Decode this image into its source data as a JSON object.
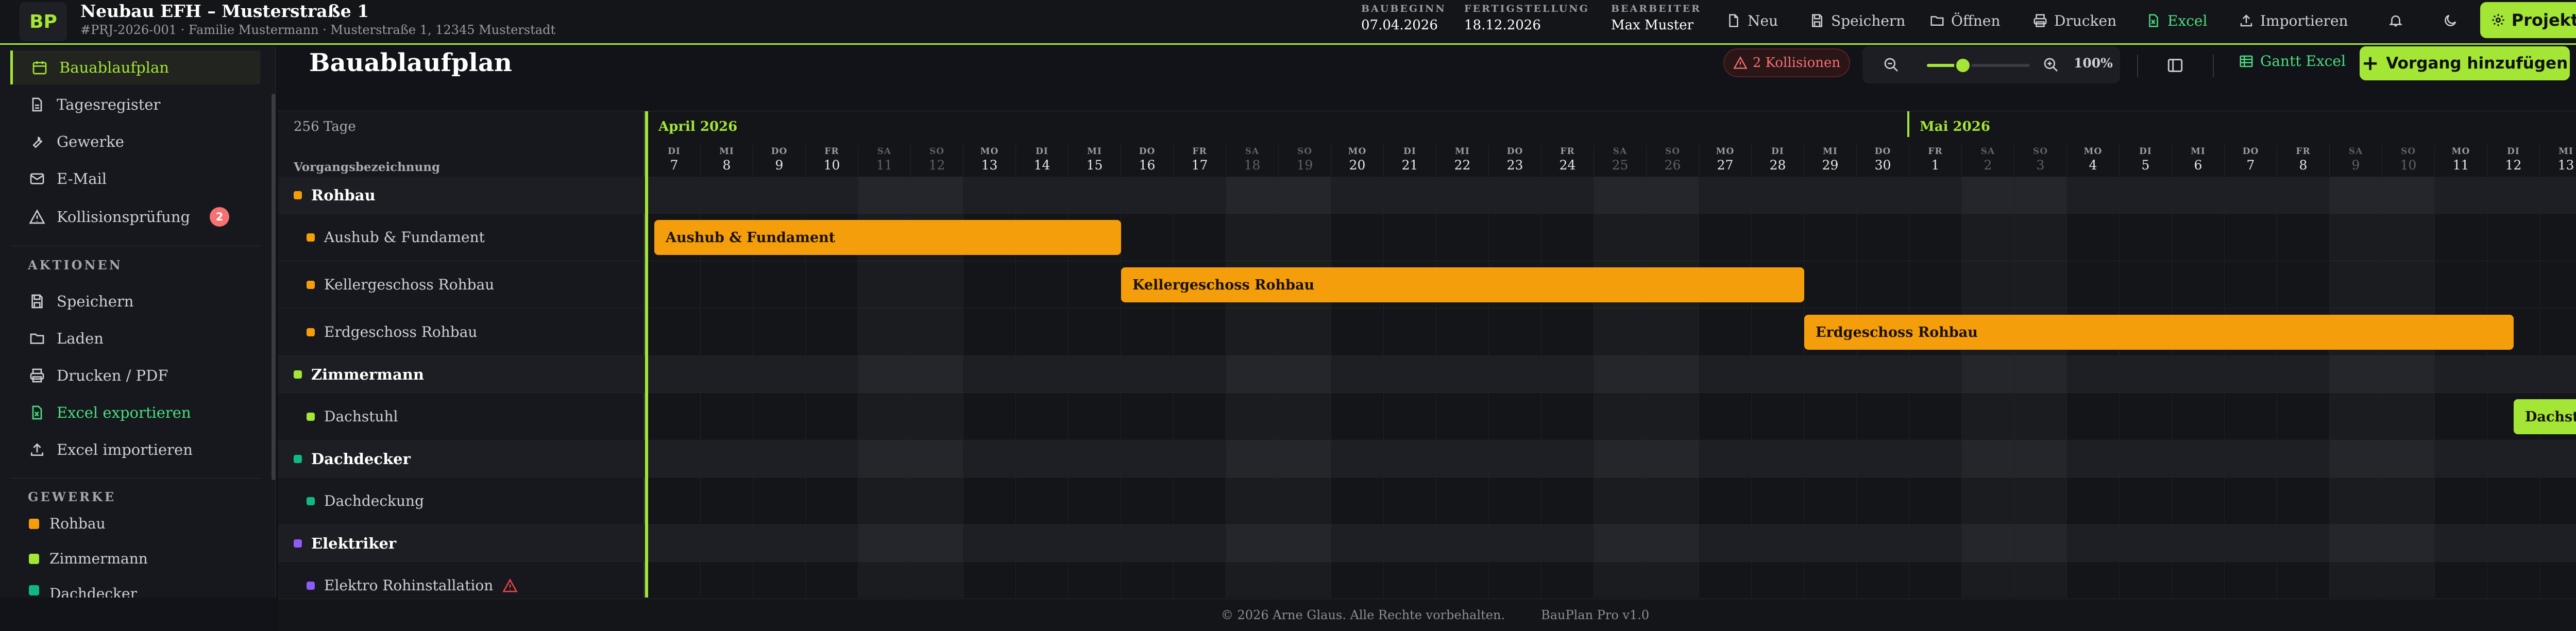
{
  "header": {
    "logo": "BP",
    "title": "Neubau EFH – Musterstraße 1",
    "subtitle": "#PRJ-2026-001 · Familie Mustermann · Musterstraße 1, 12345 Musterstadt",
    "meta": [
      {
        "label": "Baubeginn",
        "value": "07.04.2026"
      },
      {
        "label": "Fertigstellung",
        "value": "18.12.2026"
      },
      {
        "label": "Bearbeiter",
        "value": "Max Muster"
      }
    ],
    "buttons": {
      "neu": "Neu",
      "speichern": "Speichern",
      "oeffnen": "Öffnen",
      "drucken": "Drucken",
      "excel": "Excel",
      "importieren": "Importieren"
    },
    "project_button": "Projekt"
  },
  "sidebar": {
    "nav": [
      {
        "label": "Bauablaufplan",
        "icon": "calendar-icon",
        "active": true
      },
      {
        "label": "Tagesregister",
        "icon": "document-icon"
      },
      {
        "label": "Gewerke",
        "icon": "wrench-icon"
      },
      {
        "label": "E-Mail",
        "icon": "mail-icon"
      },
      {
        "label": "Kollisionsprüfung",
        "icon": "warning-icon",
        "badge": "2"
      }
    ],
    "actions_heading": "AKTIONEN",
    "actions": [
      {
        "label": "Speichern",
        "icon": "save-icon"
      },
      {
        "label": "Laden",
        "icon": "folder-icon"
      },
      {
        "label": "Drucken / PDF",
        "icon": "printer-icon"
      },
      {
        "label": "Excel exportieren",
        "icon": "excel-icon"
      },
      {
        "label": "Excel importieren",
        "icon": "upload-icon"
      }
    ],
    "trades_heading": "GEWERKE",
    "trades": [
      {
        "label": "Rohbau",
        "color": "#f59e0b"
      },
      {
        "label": "Zimmermann",
        "color": "#a3e635"
      },
      {
        "label": "Dachdecker",
        "color": "#10b981"
      }
    ]
  },
  "toolbar": {
    "page_title": "Bauablaufplan",
    "collisions": "2 Kollisionen",
    "zoom": "100%",
    "zoom_level": 0.35,
    "gantt_excel": "Gantt Excel",
    "add_button": "Vorgang hinzufügen"
  },
  "gantt": {
    "days_total": "256 Tage",
    "column_label": "Vorgangsbezeichnung",
    "months": [
      {
        "label": "April 2026",
        "start_index": 0
      },
      {
        "label": "Mai 2026",
        "start_index": 24
      }
    ],
    "days": [
      {
        "n": "DI",
        "d": "7"
      },
      {
        "n": "MI",
        "d": "8"
      },
      {
        "n": "DO",
        "d": "9"
      },
      {
        "n": "FR",
        "d": "10"
      },
      {
        "n": "SA",
        "d": "11",
        "we": true
      },
      {
        "n": "SO",
        "d": "12",
        "we": true
      },
      {
        "n": "MO",
        "d": "13"
      },
      {
        "n": "DI",
        "d": "14"
      },
      {
        "n": "MI",
        "d": "15"
      },
      {
        "n": "DO",
        "d": "16"
      },
      {
        "n": "FR",
        "d": "17"
      },
      {
        "n": "SA",
        "d": "18",
        "we": true
      },
      {
        "n": "SO",
        "d": "19",
        "we": true
      },
      {
        "n": "MO",
        "d": "20"
      },
      {
        "n": "DI",
        "d": "21"
      },
      {
        "n": "MI",
        "d": "22"
      },
      {
        "n": "DO",
        "d": "23"
      },
      {
        "n": "FR",
        "d": "24"
      },
      {
        "n": "SA",
        "d": "25",
        "we": true
      },
      {
        "n": "SO",
        "d": "26",
        "we": true
      },
      {
        "n": "MO",
        "d": "27"
      },
      {
        "n": "DI",
        "d": "28"
      },
      {
        "n": "MI",
        "d": "29"
      },
      {
        "n": "DO",
        "d": "30"
      },
      {
        "n": "FR",
        "d": "1"
      },
      {
        "n": "SA",
        "d": "2",
        "we": true
      },
      {
        "n": "SO",
        "d": "3",
        "we": true
      },
      {
        "n": "MO",
        "d": "4"
      },
      {
        "n": "DI",
        "d": "5"
      },
      {
        "n": "MI",
        "d": "6"
      },
      {
        "n": "DO",
        "d": "7"
      },
      {
        "n": "FR",
        "d": "8"
      },
      {
        "n": "SA",
        "d": "9",
        "we": true
      },
      {
        "n": "SO",
        "d": "10",
        "we": true
      },
      {
        "n": "MO",
        "d": "11"
      },
      {
        "n": "DI",
        "d": "12"
      },
      {
        "n": "MI",
        "d": "13"
      }
    ],
    "rows": [
      {
        "type": "group",
        "label": "Rohbau",
        "color": "#f59e0b"
      },
      {
        "type": "task",
        "label": "Aushub & Fundament",
        "color": "#f59e0b",
        "bar": {
          "label": "Aushub & Fundament",
          "start": 0,
          "end": 9,
          "color": "orange"
        }
      },
      {
        "type": "task",
        "label": "Kellergeschoss Rohbau",
        "color": "#f59e0b",
        "bar": {
          "label": "Kellergeschoss Rohbau",
          "start": 9,
          "end": 22,
          "color": "orange"
        }
      },
      {
        "type": "task",
        "label": "Erdgeschoss Rohbau",
        "color": "#f59e0b",
        "bar": {
          "label": "Erdgeschoss Rohbau",
          "start": 22,
          "end": 35.5,
          "color": "orange"
        }
      },
      {
        "type": "group",
        "label": "Zimmermann",
        "color": "#a3e635"
      },
      {
        "type": "task",
        "label": "Dachstuhl",
        "color": "#a3e635",
        "bar": {
          "label": "Dachstuhl",
          "start": 35.5,
          "end": 38,
          "color": "lime"
        }
      },
      {
        "type": "group",
        "label": "Dachdecker",
        "color": "#10b981"
      },
      {
        "type": "task",
        "label": "Dachdeckung",
        "color": "#10b981"
      },
      {
        "type": "group",
        "label": "Elektriker",
        "color": "#8b5cf6"
      },
      {
        "type": "task",
        "label": "Elektro Rohinstallation",
        "color": "#8b5cf6",
        "warning": true
      }
    ]
  },
  "footer": {
    "copyright": "© 2026 Arne Glaus. Alle Rechte vorbehalten.",
    "version": "BauPlan Pro v1.0"
  }
}
